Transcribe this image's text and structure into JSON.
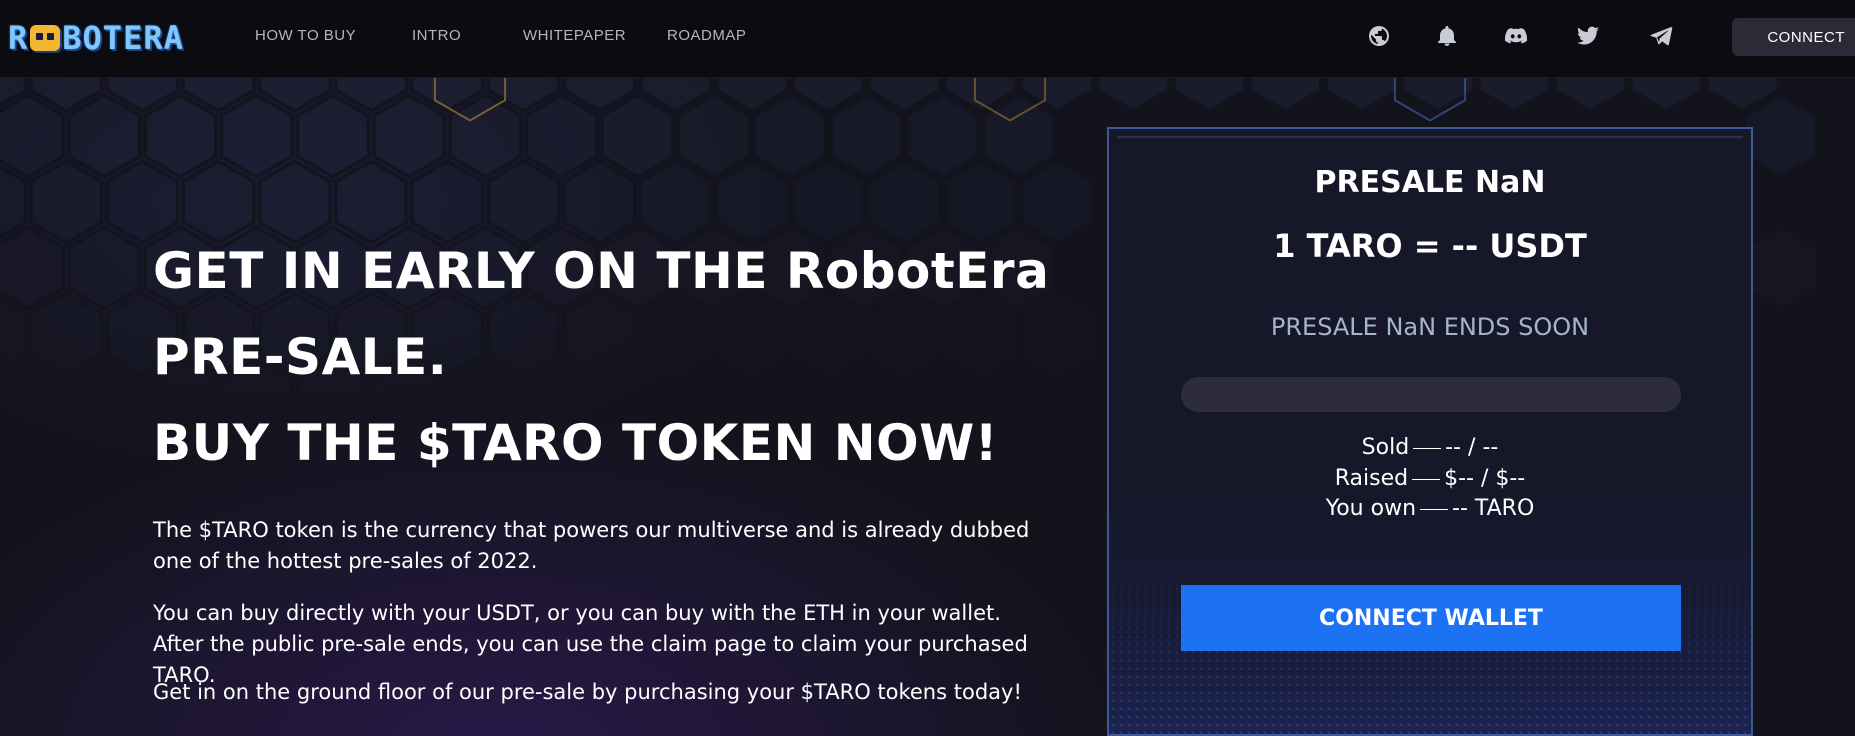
{
  "nav": {
    "logo_text_left": "R",
    "logo_text_right": "BOTERA",
    "links": [
      "HOW TO BUY",
      "INTRO",
      "WHITEPAPER",
      "ROADMAP"
    ],
    "icons": [
      "globe-icon",
      "bell-icon",
      "discord-icon",
      "twitter-icon",
      "telegram-icon"
    ],
    "connect_label": "CONNECT"
  },
  "hero": {
    "headline_line1": "GET IN EARLY ON THE RobotEra",
    "headline_line2": "PRE-SALE.",
    "headline_line3": "BUY THE $TARO TOKEN NOW!",
    "paragraph1": "The $TARO token is the currency that powers our multiverse and is already dubbed one of the hottest pre-sales of 2022.",
    "paragraph2": "You can buy directly with your USDT, or you can buy with the ETH in your wallet. After the public pre-sale ends, you can use the claim page to claim your purchased TARO.",
    "paragraph3": "Get in on the ground floor of our pre-sale by purchasing your $TARO tokens today!"
  },
  "presale": {
    "title": "PRESALE NaN",
    "rate": "1 TARO = -- USDT",
    "ends_text": "PRESALE NaN ENDS SOON",
    "progress_fraction": 0,
    "sold_label": "Sold",
    "sold_value": "-- / --",
    "raised_label": "Raised",
    "raised_value": "$-- / $--",
    "own_label": "You own",
    "own_value": "-- TARO",
    "wallet_button": "CONNECT WALLET"
  },
  "colors": {
    "accent_blue": "#1d72f3",
    "background": "#13131c",
    "nav_background": "#0b0b10",
    "card_border": "#3f5898"
  }
}
